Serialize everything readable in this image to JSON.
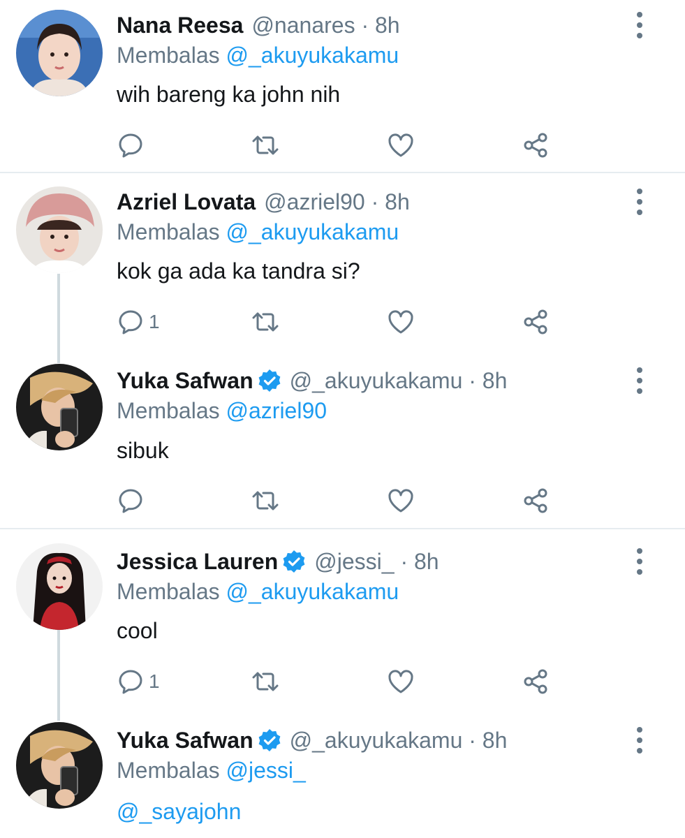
{
  "tweets": [
    {
      "name": "Nana Reesa",
      "verified": false,
      "handle_time": "@nanares · 8h",
      "reply_prefix": "Membalas",
      "reply_to": "@_akuyukakamu",
      "text": "wih bareng ka john nih",
      "reply_count": "",
      "avatar": "avatar-nana-reesa"
    },
    {
      "name": "Azriel Lovata",
      "verified": false,
      "handle_time": "@azriel90 · 8h",
      "reply_prefix": "Membalas",
      "reply_to": "@_akuyukakamu",
      "text": "kok ga ada ka tandra si?",
      "reply_count": "1",
      "avatar": "avatar-azriel-lovata"
    },
    {
      "name": "Yuka Safwan",
      "verified": true,
      "handle_time": "@_akuyukakamu · 8h",
      "reply_prefix": "Membalas",
      "reply_to": "@azriel90",
      "text": "sibuk",
      "reply_count": "",
      "avatar": "avatar-yuka-safwan"
    },
    {
      "name": "Jessica Lauren",
      "verified": true,
      "handle_time": "@jessi_ · 8h",
      "reply_prefix": "Membalas",
      "reply_to": "@_akuyukakamu",
      "text": "cool",
      "reply_count": "1",
      "avatar": "avatar-jessica-lauren"
    },
    {
      "name": "Yuka Safwan",
      "verified": true,
      "handle_time": "@_akuyukakamu · 8h",
      "reply_prefix": "Membalas",
      "reply_to": "@jessi_",
      "text": "@_sayajohn",
      "reply_count": "",
      "avatar": "avatar-yuka-safwan"
    }
  ],
  "colors": {
    "link": "#1d9bf0",
    "secondary_text": "#657786",
    "divider": "#e6ecf0",
    "verified": "#1d9bf0"
  },
  "icons": [
    "reply-icon",
    "retweet-icon",
    "like-icon",
    "share-icon",
    "more-icon",
    "verified-badge-icon"
  ]
}
